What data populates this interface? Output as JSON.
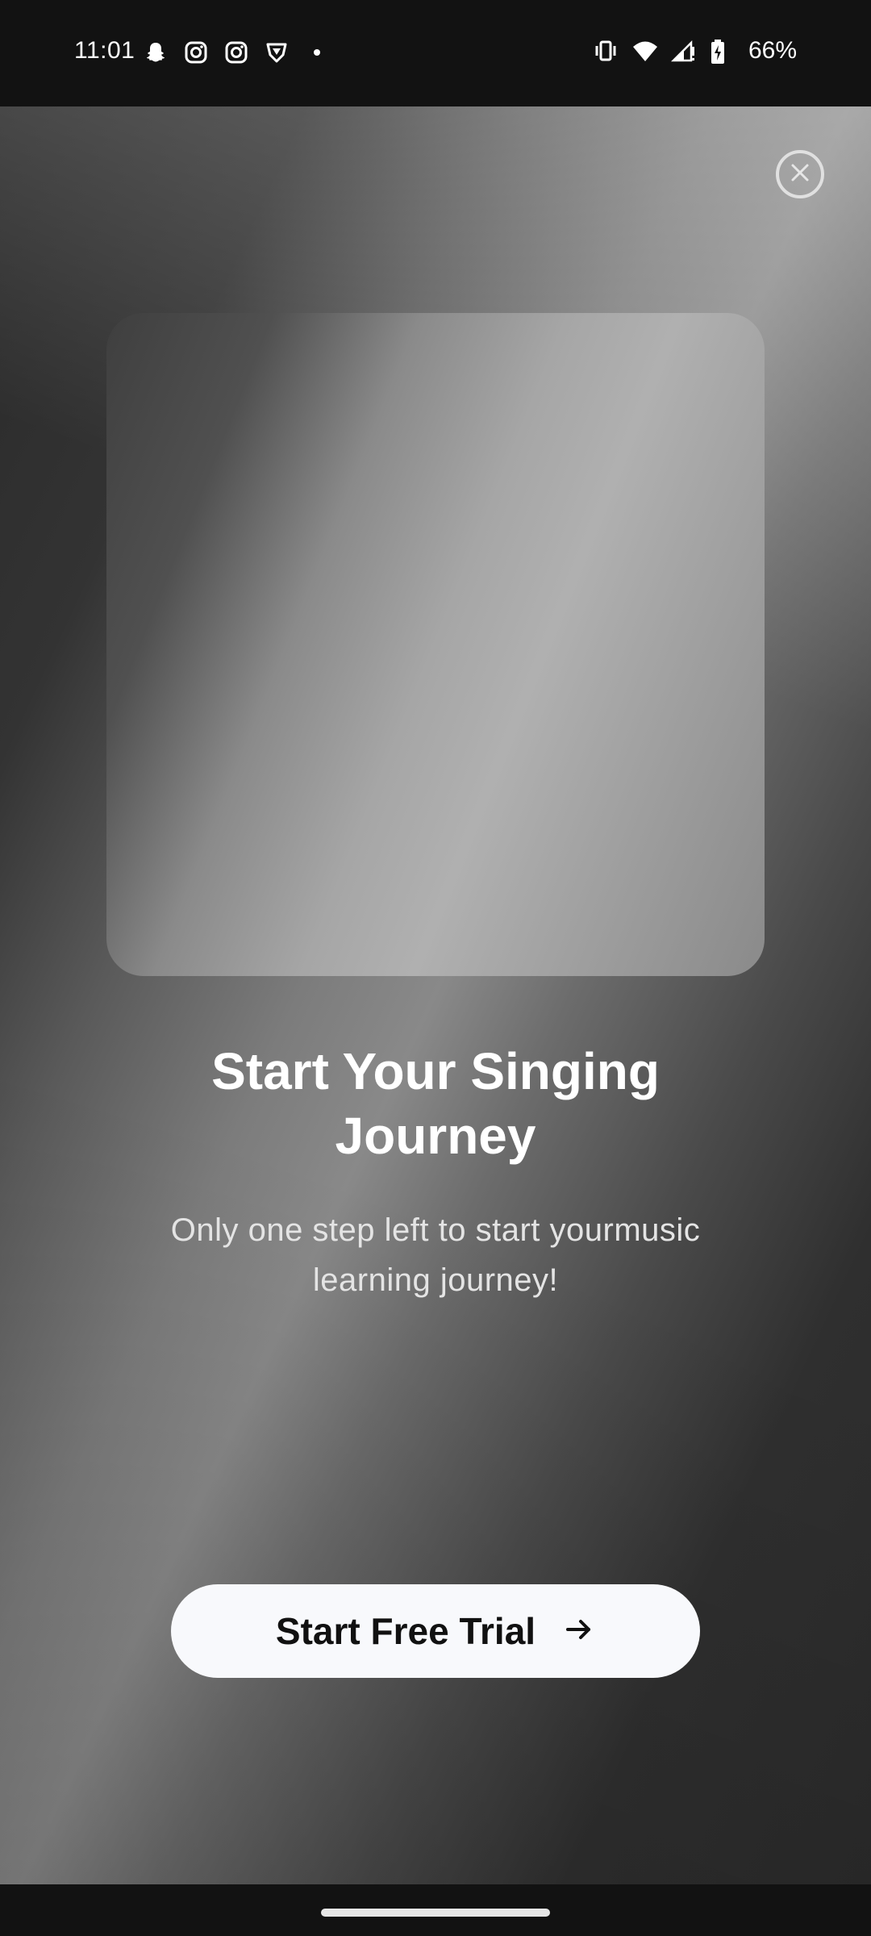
{
  "status_bar": {
    "time": "11:01",
    "left_icons": [
      "snapchat-icon",
      "instagram-icon",
      "instagram-icon",
      "vpn-shield-icon",
      "dot-icon"
    ],
    "right_icons": [
      "vibrate-icon",
      "wifi-icon",
      "cellular-signal-icon",
      "battery-charging-icon"
    ],
    "battery_percent": "66%"
  },
  "paywall": {
    "close_icon": "close-icon",
    "hero_image": "promo-image-placeholder",
    "headline": "Start Your Singing Journey",
    "subtitle": "Only one step left to start yourmusic learning journey!",
    "cta": {
      "label": "Start Free Trial",
      "icon": "arrow-right-icon"
    }
  },
  "nav_bar": {
    "indicator": "home-indicator"
  },
  "colors": {
    "status_bar_bg": "#121212",
    "cta_bg": "#f8f9fc",
    "text_primary": "#ffffff"
  }
}
